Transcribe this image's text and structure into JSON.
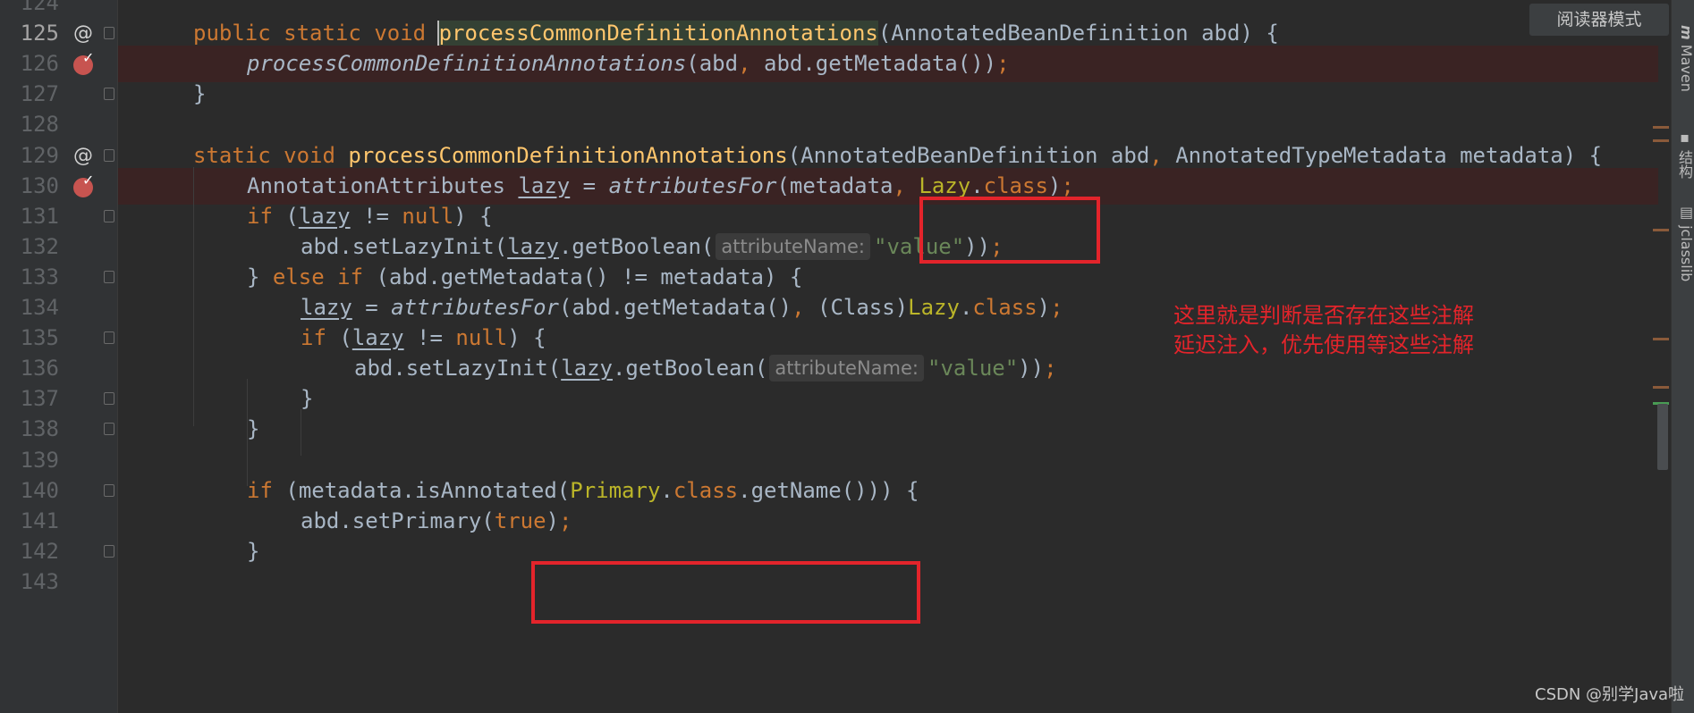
{
  "editor": {
    "lines": [
      {
        "num": "124",
        "type": "blank"
      },
      {
        "num": "125",
        "type": "l125"
      },
      {
        "num": "126",
        "type": "l126"
      },
      {
        "num": "127",
        "type": "l127"
      },
      {
        "num": "128",
        "type": "blank"
      },
      {
        "num": "129",
        "type": "l129"
      },
      {
        "num": "130",
        "type": "l130"
      },
      {
        "num": "131",
        "type": "l131"
      },
      {
        "num": "132",
        "type": "l132"
      },
      {
        "num": "133",
        "type": "l133"
      },
      {
        "num": "134",
        "type": "l134"
      },
      {
        "num": "135",
        "type": "l135"
      },
      {
        "num": "136",
        "type": "l136"
      },
      {
        "num": "137",
        "type": "l137"
      },
      {
        "num": "138",
        "type": "l138"
      },
      {
        "num": "139",
        "type": "blank"
      },
      {
        "num": "140",
        "type": "l140"
      },
      {
        "num": "141",
        "type": "l141"
      },
      {
        "num": "142",
        "type": "l142"
      },
      {
        "num": "143",
        "type": "blank"
      }
    ],
    "code": {
      "kw_public": "public",
      "kw_static": "static",
      "kw_void": "void",
      "kw_if": "if",
      "kw_else": "else",
      "kw_null": "null",
      "kw_true": "true",
      "kw_class": "class",
      "fn_process": "processCommonDefinitionAnnotations",
      "t_abd_type": "AnnotatedBeanDefinition",
      "t_abd": "abd",
      "t_meta_type": "AnnotatedTypeMetadata",
      "t_metadata": "metadata",
      "t_attr_type": "AnnotationAttributes",
      "t_lazy": "lazy",
      "t_attributesFor": "attributesFor",
      "t_Lazy": "Lazy",
      "t_Primary": "Primary",
      "t_getMetadata": "abd.getMetadata()",
      "t_setLazyInit": "abd.setLazyInit(",
      "t_getBoolean": ".getBoolean(",
      "t_value": "\"value\"",
      "t_class_cast": "(Class)",
      "t_isAnnotated": "metadata.isAnnotated(",
      "t_getName": "getName",
      "t_setPrimary": "abd.setPrimary(",
      "hint_attr": "attributeName:",
      "gutter_at": "@"
    }
  },
  "annotation": {
    "note_line1": "这里就是判断是否存在这些注解",
    "note_line2": "延迟注入，优先使用等这些注解",
    "box_color": "#e3242b"
  },
  "toolbar": {
    "reader_mode": "阅读器模式"
  },
  "right_sidebar": {
    "maven": "Maven",
    "structure": "结构",
    "jclasslib": "jclasslib"
  },
  "watermark": "CSDN @别学Java啦",
  "colors": {
    "keyword": "#cc7832",
    "function": "#ffc66d",
    "string": "#6a8759",
    "annotation": "#bbb529",
    "text": "#a9b7c6",
    "background": "#2b2b2b"
  }
}
